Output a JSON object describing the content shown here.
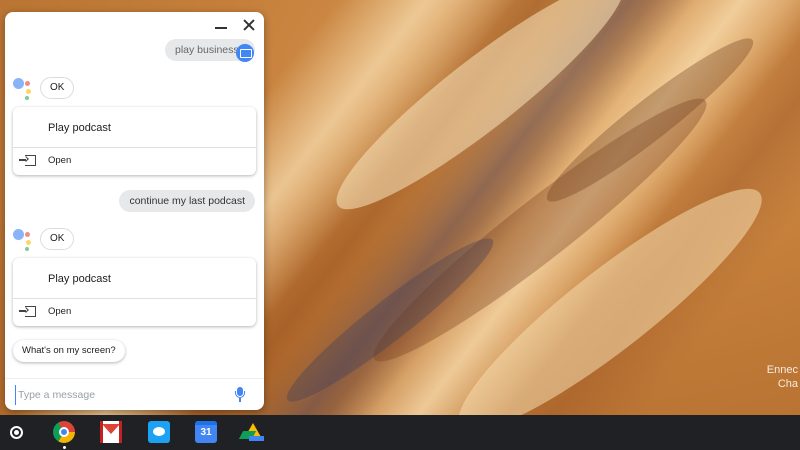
{
  "wallpaper": {
    "map_label_line1": "Ennec",
    "map_label_line2": "Cha"
  },
  "assistant": {
    "window_controls": [
      "minimize",
      "close"
    ],
    "messages": [
      {
        "role": "user",
        "text": "play business da"
      },
      {
        "role": "assistant",
        "chip": "OK",
        "card": {
          "title": "Play podcast",
          "action_label": "Open"
        }
      },
      {
        "role": "user",
        "text": "continue my last podcast"
      },
      {
        "role": "assistant",
        "chip": "OK",
        "card": {
          "title": "Play podcast",
          "action_label": "Open"
        }
      }
    ],
    "suggestion": "What's on my screen?",
    "input": {
      "placeholder": "Type a message",
      "value": ""
    },
    "accent_color": "#4285f4"
  },
  "shelf": {
    "apps": [
      {
        "name": "Chrome",
        "icon": "chrome-icon",
        "running": true
      },
      {
        "name": "Gmail",
        "icon": "gmail-icon"
      },
      {
        "name": "Twitter",
        "icon": "twitter-icon"
      },
      {
        "name": "Google Calendar",
        "icon": "calendar-icon",
        "label": "31"
      },
      {
        "name": "Google Drive",
        "icon": "drive-icon"
      }
    ]
  }
}
